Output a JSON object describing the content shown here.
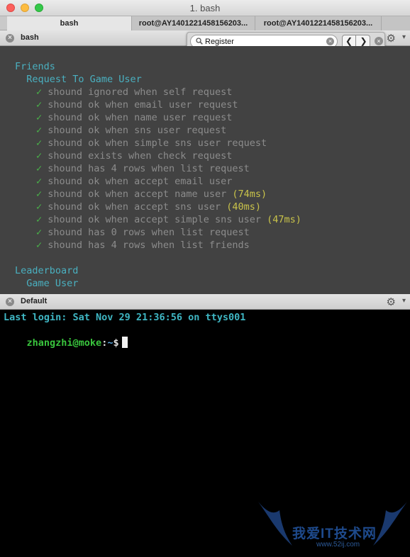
{
  "window": {
    "title": "1. bash"
  },
  "tabs": [
    {
      "label": "bash",
      "active": true
    },
    {
      "label": "root@AY1401221458156203...",
      "active": false
    },
    {
      "label": "root@AY1401221458156203...",
      "active": false
    }
  ],
  "top_pane": {
    "label": "bash",
    "search": {
      "value": "Register",
      "placeholder": ""
    },
    "lines": [
      {
        "kind": "heading",
        "text": "Friends",
        "indent": 2
      },
      {
        "kind": "heading",
        "text": "Request To Game User",
        "indent": 4
      },
      {
        "kind": "pass",
        "text": "shound ignored when self request",
        "duration": ""
      },
      {
        "kind": "pass",
        "text": "shound ok when email user request",
        "duration": ""
      },
      {
        "kind": "pass",
        "text": "shound ok when name user request",
        "duration": ""
      },
      {
        "kind": "pass",
        "text": "shound ok when sns user request",
        "duration": ""
      },
      {
        "kind": "pass",
        "text": "shound ok when simple sns user request",
        "duration": ""
      },
      {
        "kind": "pass",
        "text": "shound exists when check request",
        "duration": ""
      },
      {
        "kind": "pass",
        "text": "shound has 4 rows when list request",
        "duration": ""
      },
      {
        "kind": "pass",
        "text": "shound ok when accept email user",
        "duration": ""
      },
      {
        "kind": "pass",
        "text": "shound ok when accept name user",
        "duration": "(74ms)"
      },
      {
        "kind": "pass",
        "text": "shound ok when accept sns user",
        "duration": "(40ms)"
      },
      {
        "kind": "pass",
        "text": "shound ok when accept simple sns user",
        "duration": "(47ms)"
      },
      {
        "kind": "pass",
        "text": "shound has 0 rows when list request",
        "duration": ""
      },
      {
        "kind": "pass",
        "text": "shound has 4 rows when list friends",
        "duration": ""
      },
      {
        "kind": "blank",
        "text": ""
      },
      {
        "kind": "heading",
        "text": "Leaderboard",
        "indent": 2
      },
      {
        "kind": "heading",
        "text": "Game User",
        "indent": 4
      }
    ]
  },
  "bottom_pane": {
    "label": "Default",
    "last_login": "Last login: Sat Nov 29 21:36:56 on ttys001",
    "prompt": {
      "user_host": "zhangzhi@moke",
      "separator": ":",
      "path": "~",
      "sign": "$"
    }
  },
  "icons": {
    "check": "check-mark",
    "gear": "gear-icon",
    "close": "close-icon",
    "search": "search-icon"
  },
  "colors": {
    "top_bg": "#424242",
    "heading": "#4ab0c0",
    "pass_text": "#8c8c8c",
    "check": "#49b649",
    "duration": "#c9c34a",
    "bottom_bg": "#000000"
  },
  "watermark": {
    "text": "我爱IT技术网",
    "url": "www.52ij.com"
  }
}
